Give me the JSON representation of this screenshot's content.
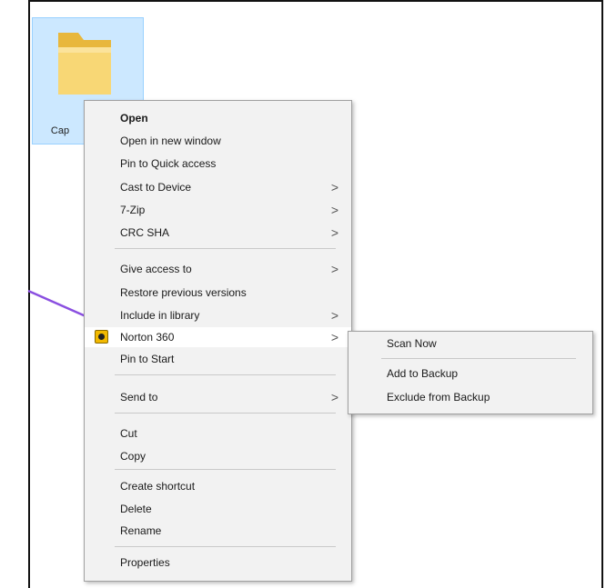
{
  "file": {
    "label": "Cap",
    "icon": "folder-icon"
  },
  "context_menu": {
    "items": [
      {
        "label": "Open",
        "bold": true
      },
      {
        "label": "Open in new window"
      },
      {
        "label": "Pin to Quick access"
      },
      {
        "label": "Cast to Device",
        "submenu": true
      },
      {
        "label": "7-Zip",
        "submenu": true
      },
      {
        "label": "CRC SHA",
        "submenu": true
      },
      {
        "label": "Give access to",
        "submenu": true
      },
      {
        "label": "Restore previous versions"
      },
      {
        "label": "Include in library",
        "submenu": true
      },
      {
        "label": "Norton 360",
        "submenu": true,
        "highlighted": true,
        "icon": "norton-icon"
      },
      {
        "label": "Pin to Start"
      },
      {
        "label": "Send to",
        "submenu": true
      },
      {
        "label": "Cut"
      },
      {
        "label": "Copy"
      },
      {
        "label": "Create shortcut"
      },
      {
        "label": "Delete"
      },
      {
        "label": "Rename"
      },
      {
        "label": "Properties"
      }
    ],
    "chevron": ">"
  },
  "norton_submenu": {
    "items": [
      {
        "label": "Scan Now"
      },
      {
        "label": "Add to Backup"
      },
      {
        "label": "Exclude from Backup"
      }
    ]
  },
  "colors": {
    "selection": "#cce8ff",
    "menu_bg": "#f2f2f2",
    "arrow": "#8a4fe0"
  }
}
